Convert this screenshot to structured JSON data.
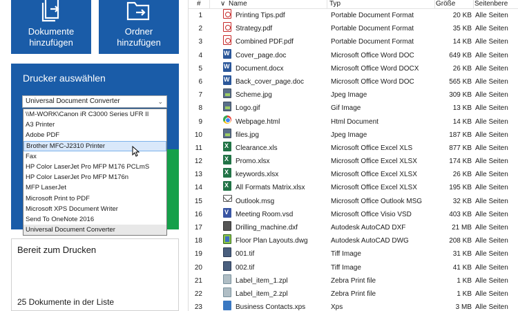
{
  "tiles": {
    "add_documents": "Dokumente\nhinzufügen",
    "add_documents_line1": "Dokumente",
    "add_documents_line2": "hinzufügen",
    "add_folder_line1": "Ordner",
    "add_folder_line2": "hinzufügen"
  },
  "printer": {
    "title": "Drucker auswählen",
    "selected": "Universal Document Converter",
    "options": [
      "\\\\M-WORK\\Canon iR C3000 Series UFR II",
      "A3 Printer",
      "Adobe PDF",
      "Brother MFC-J2310 Printer",
      "Fax",
      "HP Color LaserJet Pro MFP M176 PCLmS",
      "HP Color LaserJet Pro MFP M176n",
      "MFP LaserJet",
      "Microsoft Print to PDF",
      "Microsoft XPS Document Writer",
      "Send To OneNote 2016",
      "Universal Document Converter"
    ]
  },
  "status": {
    "message": "Bereit zum Drucken",
    "count": "25 Dokumente in der Liste"
  },
  "table": {
    "headers": {
      "num": "#",
      "name": "Name",
      "type": "Typ",
      "size": "Größe",
      "pages": "Seitenbere"
    },
    "rows": [
      {
        "num": "1",
        "name": "Printing Tips.pdf",
        "type": "Portable Document Format",
        "size": "20 KB",
        "pages": "Alle Seiten",
        "icon": "pdf"
      },
      {
        "num": "2",
        "name": "Strategy.pdf",
        "type": "Portable Document Format",
        "size": "35 KB",
        "pages": "Alle Seiten",
        "icon": "pdf"
      },
      {
        "num": "3",
        "name": "Combined PDF.pdf",
        "type": "Portable Document Format",
        "size": "14 KB",
        "pages": "Alle Seiten",
        "icon": "pdf"
      },
      {
        "num": "4",
        "name": "Cover_page.doc",
        "type": "Microsoft Office Word DOC",
        "size": "649 KB",
        "pages": "Alle Seiten",
        "icon": "word"
      },
      {
        "num": "5",
        "name": "Document.docx",
        "type": "Microsoft Office Word DOCX",
        "size": "26 KB",
        "pages": "Alle Seiten",
        "icon": "word"
      },
      {
        "num": "6",
        "name": "Back_cover_page.doc",
        "type": "Microsoft Office Word DOC",
        "size": "565 KB",
        "pages": "Alle Seiten",
        "icon": "word"
      },
      {
        "num": "7",
        "name": "Scheme.jpg",
        "type": "Jpeg Image",
        "size": "309 KB",
        "pages": "Alle Seiten",
        "icon": "img"
      },
      {
        "num": "8",
        "name": "Logo.gif",
        "type": "Gif Image",
        "size": "13 KB",
        "pages": "Alle Seiten",
        "icon": "img"
      },
      {
        "num": "9",
        "name": "Webpage.html",
        "type": "Html Document",
        "size": "14 KB",
        "pages": "Alle Seiten",
        "icon": "html"
      },
      {
        "num": "10",
        "name": "files.jpg",
        "type": "Jpeg Image",
        "size": "187 KB",
        "pages": "Alle Seiten",
        "icon": "img"
      },
      {
        "num": "11",
        "name": "Clearance.xls",
        "type": "Microsoft Office Excel XLS",
        "size": "877 KB",
        "pages": "Alle Seiten",
        "icon": "xls"
      },
      {
        "num": "12",
        "name": "Promo.xlsx",
        "type": "Microsoft Office Excel XLSX",
        "size": "174 KB",
        "pages": "Alle Seiten",
        "icon": "xls"
      },
      {
        "num": "13",
        "name": "keywords.xlsx",
        "type": "Microsoft Office Excel XLSX",
        "size": "26 KB",
        "pages": "Alle Seiten",
        "icon": "xls"
      },
      {
        "num": "14",
        "name": "All Formats Matrix.xlsx",
        "type": "Microsoft Office Excel XLSX",
        "size": "195 KB",
        "pages": "Alle Seiten",
        "icon": "xls"
      },
      {
        "num": "15",
        "name": "Outlook.msg",
        "type": "Microsoft Office Outlook MSG",
        "size": "32 KB",
        "pages": "Alle Seiten",
        "icon": "msg"
      },
      {
        "num": "16",
        "name": "Meeting Room.vsd",
        "type": "Microsoft Office Visio VSD",
        "size": "403 KB",
        "pages": "Alle Seiten",
        "icon": "vsd"
      },
      {
        "num": "17",
        "name": "Drilling_machine.dxf",
        "type": "Autodesk AutoCAD DXF",
        "size": "21 MB",
        "pages": "Alle Seiten",
        "icon": "dxf"
      },
      {
        "num": "18",
        "name": "Floor Plan Layouts.dwg",
        "type": "Autodesk AutoCAD DWG",
        "size": "208 KB",
        "pages": "Alle Seiten",
        "icon": "dwg"
      },
      {
        "num": "19",
        "name": "001.tif",
        "type": "Tiff Image",
        "size": "31 KB",
        "pages": "Alle Seiten",
        "icon": "tif"
      },
      {
        "num": "20",
        "name": "002.tif",
        "type": "Tiff Image",
        "size": "41 KB",
        "pages": "Alle Seiten",
        "icon": "tif"
      },
      {
        "num": "21",
        "name": "Label_item_1.zpl",
        "type": "Zebra Print file",
        "size": "1 KB",
        "pages": "Alle Seiten",
        "icon": "zpl"
      },
      {
        "num": "22",
        "name": "Label_item_2.zpl",
        "type": "Zebra Print file",
        "size": "1 KB",
        "pages": "Alle Seiten",
        "icon": "zpl"
      },
      {
        "num": "23",
        "name": "Business Contacts.xps",
        "type": "Xps",
        "size": "3 MB",
        "pages": "Alle Seiten",
        "icon": "xps"
      }
    ]
  },
  "colors": {
    "accent": "#1a5ca8",
    "green": "#15a04a",
    "highlight": "#d9e8fa"
  }
}
